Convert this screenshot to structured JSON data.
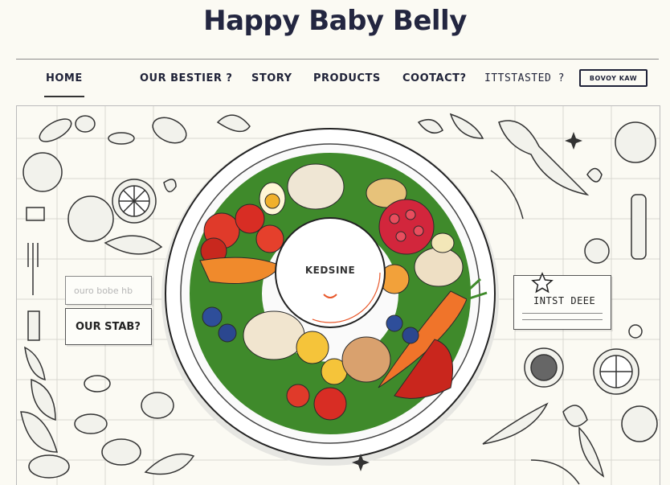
{
  "header": {
    "title": "Happy Baby Belly"
  },
  "nav": {
    "items": [
      {
        "label": "HOME"
      },
      {
        "label": "OUR BESTIER ?"
      },
      {
        "label": "STORY"
      },
      {
        "label": "PRODUCTS"
      },
      {
        "label": "COOTACT?"
      },
      {
        "label": "ITTSTASTED ?"
      }
    ],
    "button_label": "BOVOY KAW"
  },
  "hero": {
    "plate_label": "KEDSINE",
    "card_faded_text": "ouro bobe hb",
    "card_left_label": "OUR STAB?",
    "card_right_label": "INTST DEEE"
  },
  "colors": {
    "title": "#232640",
    "background": "#fbfaf3",
    "accent": "#e8572a"
  }
}
